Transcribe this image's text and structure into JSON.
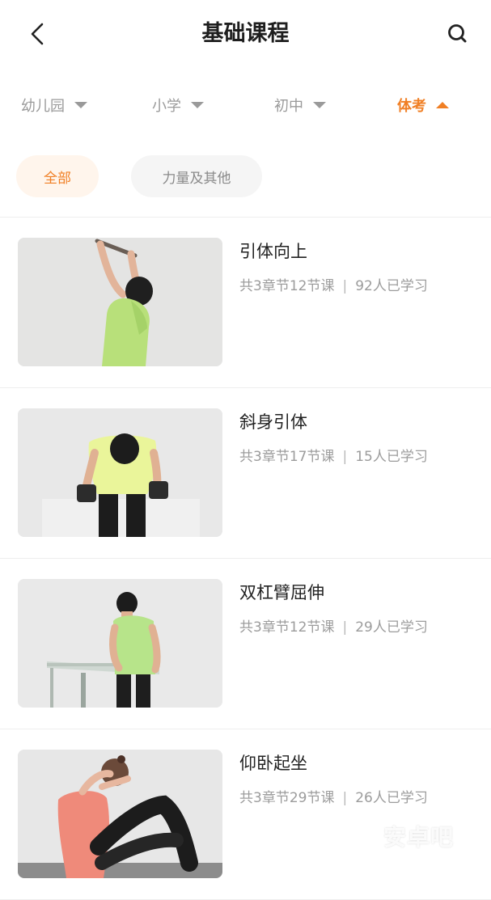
{
  "header": {
    "title": "基础课程",
    "back_icon": "chevron-left-icon",
    "search_icon": "search-icon"
  },
  "filters": [
    {
      "label": "幼儿园",
      "active": false
    },
    {
      "label": "小学",
      "active": false
    },
    {
      "label": "初中",
      "active": false
    },
    {
      "label": "体考",
      "active": true
    }
  ],
  "chips": [
    {
      "label": "全部",
      "active": true
    },
    {
      "label": "力量及其他",
      "active": false
    }
  ],
  "courses": [
    {
      "title": "引体向上",
      "chapters": "共3章节12节课",
      "learners": "92人已学习"
    },
    {
      "title": "斜身引体",
      "chapters": "共3章节17节课",
      "learners": "15人已学习"
    },
    {
      "title": "双杠臂屈伸",
      "chapters": "共3章节12节课",
      "learners": "29人已学习"
    },
    {
      "title": "仰卧起坐",
      "chapters": "共3章节29节课",
      "learners": "26人已学习"
    }
  ],
  "watermark": "安卓吧",
  "colors": {
    "accent": "#f07f24",
    "accent_bg": "#fff5ec",
    "chip_bg": "#f5f5f5",
    "text_primary": "#222222",
    "text_secondary": "#9c9c9c"
  }
}
